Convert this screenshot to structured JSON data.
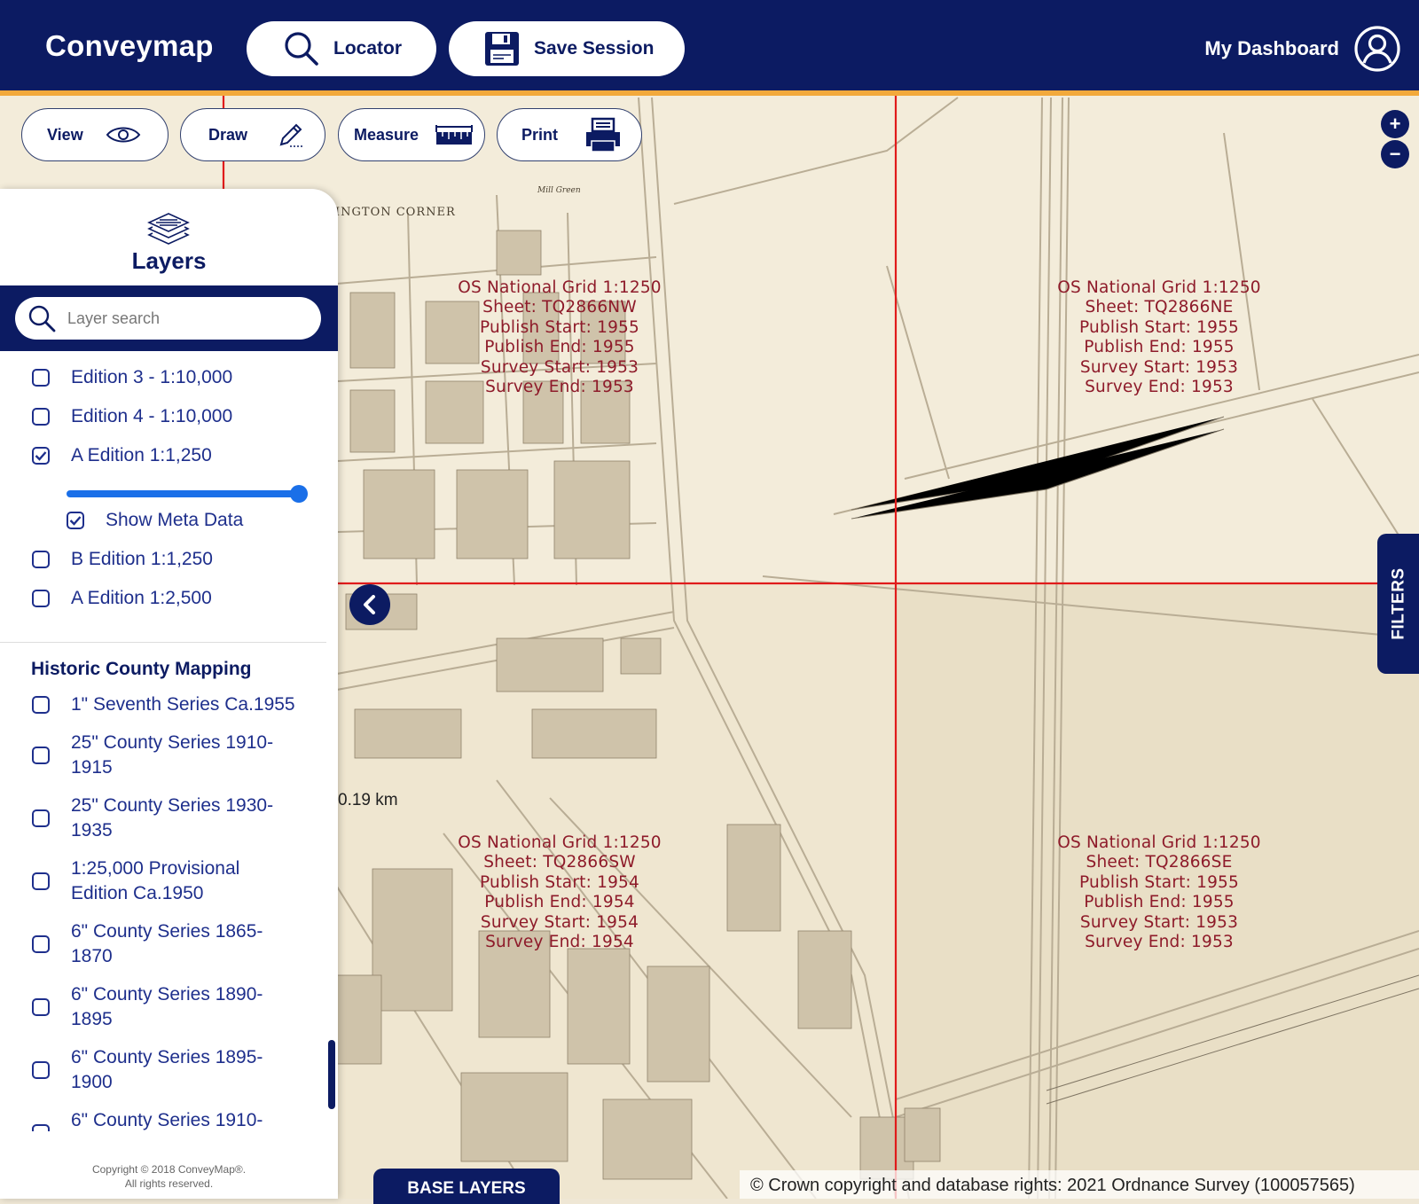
{
  "header": {
    "brand": "Conveymap",
    "locator_label": "Locator",
    "save_session_label": "Save Session",
    "dashboard_label": "My Dashboard"
  },
  "toolbar": {
    "view_label": "View",
    "draw_label": "Draw",
    "measure_label": "Measure",
    "print_label": "Print"
  },
  "zoom": {
    "in": "+",
    "out": "−"
  },
  "map": {
    "filters_label": "FILTERS",
    "scale_label": "0.19 km",
    "base_layers_label": "BASE LAYERS",
    "copyright": "© Crown copyright and database rights: 2021 Ordnance Survey (100057565)",
    "place_labels": {
      "corner": "INGTON CORNER",
      "mill_green": "Mill Green"
    },
    "sheets": [
      {
        "lines": [
          "OS National Grid 1:1250",
          "Sheet: TQ2866NW",
          "Publish Start: 1955",
          "Publish End: 1955",
          "Survey Start: 1953",
          "Survey End: 1953"
        ]
      },
      {
        "lines": [
          "OS National Grid 1:1250",
          "Sheet: TQ2866NE",
          "Publish Start: 1955",
          "Publish End: 1955",
          "Survey Start: 1953",
          "Survey End: 1953"
        ]
      },
      {
        "lines": [
          "OS National Grid 1:1250",
          "Sheet: TQ2866SW",
          "Publish Start: 1954",
          "Publish End: 1954",
          "Survey Start: 1954",
          "Survey End: 1954"
        ]
      },
      {
        "lines": [
          "OS National Grid 1:1250",
          "Sheet: TQ2866SE",
          "Publish Start: 1955",
          "Publish End: 1955",
          "Survey Start: 1953",
          "Survey End: 1953"
        ]
      }
    ]
  },
  "panel": {
    "title": "Layers",
    "search_placeholder": "Layer search",
    "layers": [
      {
        "label": "Edition 3 - 1:10,000",
        "checked": false
      },
      {
        "label": "Edition 4 - 1:10,000",
        "checked": false
      },
      {
        "label": "A Edition 1:1,250",
        "checked": true
      },
      {
        "label": "B Edition 1:1,250",
        "checked": false
      },
      {
        "label": "A Edition 1:2,500",
        "checked": false
      }
    ],
    "opacity": 1.0,
    "meta_label": "Show Meta Data",
    "meta_checked": true,
    "historic_title": "Historic County Mapping",
    "historic": [
      {
        "line1": "1\" Seventh Series Ca.1955",
        "line2": ""
      },
      {
        "line1": "25\" County Series 1910-",
        "line2": "1915"
      },
      {
        "line1": "25\" County Series 1930-",
        "line2": "1935"
      },
      {
        "line1": "1:25,000 Provisional",
        "line2": "Edition Ca.1950"
      },
      {
        "line1": "6\" County Series 1865-",
        "line2": "1870"
      },
      {
        "line1": "6\" County Series 1890-",
        "line2": "1895"
      },
      {
        "line1": "6\" County Series 1895-",
        "line2": "1900"
      },
      {
        "line1": "6\" County Series 1910-",
        "line2": ""
      }
    ],
    "copyright_line1": "Copyright © 2018 ConveyMap®.",
    "copyright_line2": "All rights reserved."
  },
  "colors": {
    "navy": "#0c1b62",
    "accent": "#f2a93b",
    "grid": "#e01b1b",
    "label": "#8e1b2a",
    "slider": "#1a6fe8"
  },
  "icons": [
    "search-icon",
    "save-icon",
    "user-icon",
    "eye-icon",
    "pencil-icon",
    "ruler-icon",
    "printer-icon",
    "layers-icon",
    "chevron-left-icon",
    "checkbox-icon"
  ]
}
